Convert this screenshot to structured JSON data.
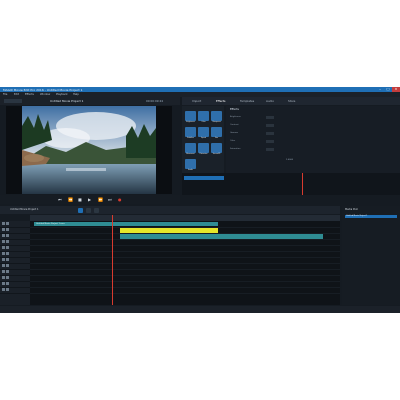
{
  "window": {
    "title": "MAGIX Movie Edit Pro 2016 - Untitled Movie Project 1"
  },
  "menu": {
    "items": [
      "File",
      "Edit",
      "Effects",
      "Window",
      "Playback",
      "Help"
    ]
  },
  "preview": {
    "title": "Untitled Movie Project 1",
    "timecode": "00:00:09:24"
  },
  "media_tabs": [
    "Import",
    "Effects",
    "Templates",
    "Audio",
    "Store"
  ],
  "media_pool": {
    "tiles": [
      "Brightness",
      "Color",
      "Sharpness",
      "Stabilize",
      "Speed",
      "Size",
      "Movement",
      "Distortion",
      "Stereo3D",
      "Audio"
    ]
  },
  "properties": {
    "header": "Effects",
    "rows": [
      "Brightness",
      "Contrast",
      "Gamma",
      "Color",
      "Saturation"
    ],
    "value_label": "1,0000"
  },
  "timeline": {
    "tab_label": "Untitled Movie Project 1",
    "project_clip": "Untitled Movie Project 1.mxv"
  },
  "right_panel": {
    "header": "Media Pool",
    "item": "Untitled Movie Project 1"
  },
  "colors": {
    "accent": "#1f6fb5",
    "clip_teal": "#2f8c93",
    "clip_yellow": "#e6e62a",
    "playhead": "#d83b2f"
  }
}
